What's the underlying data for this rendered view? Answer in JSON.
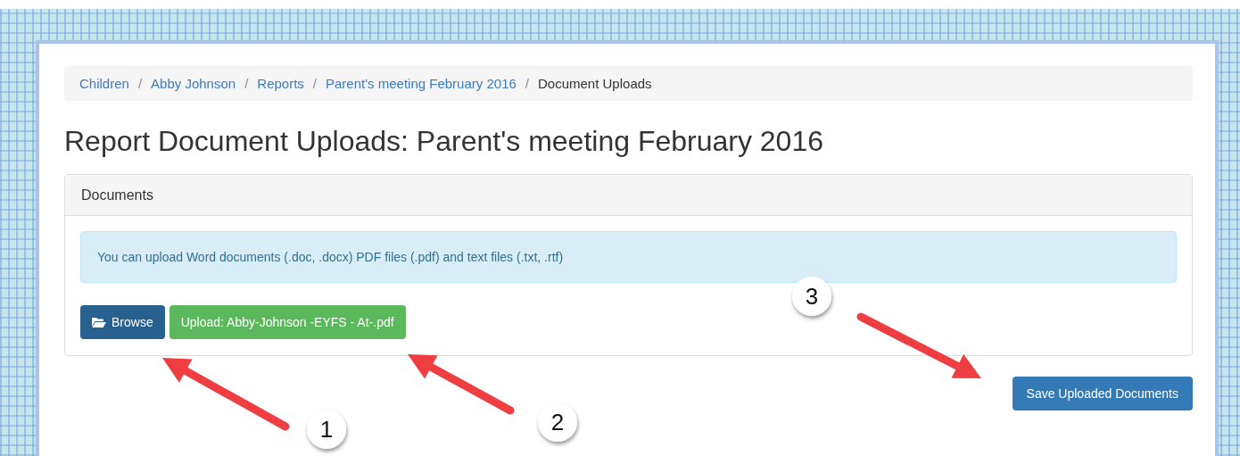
{
  "breadcrumb": [
    {
      "label": "Children",
      "active": false
    },
    {
      "label": "Abby Johnson",
      "active": false
    },
    {
      "label": "Reports",
      "active": false
    },
    {
      "label": "Parent's meeting February 2016",
      "active": false
    },
    {
      "label": "Document Uploads",
      "active": true
    }
  ],
  "separator": "/",
  "title": "Report Document Uploads: Parent's meeting February 2016",
  "panel": {
    "heading": "Documents",
    "info": "You can upload Word documents (.doc, .docx) PDF files (.pdf) and text files (.txt, .rtf)",
    "browse_button": "Browse",
    "upload_button": "Upload: Abby-Johnson -EYFS - At-.pdf"
  },
  "save_button": "Save Uploaded Documents",
  "annotations": [
    {
      "label": "1"
    },
    {
      "label": "2"
    },
    {
      "label": "3"
    }
  ]
}
